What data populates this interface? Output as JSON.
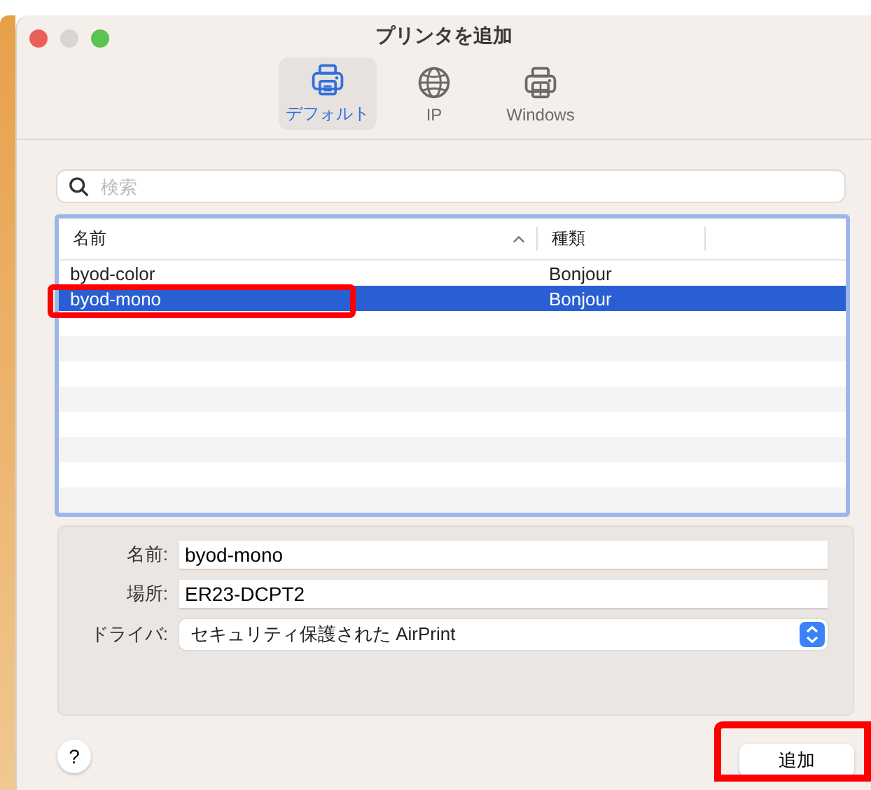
{
  "window": {
    "title": "プリンタを追加"
  },
  "tabs": [
    {
      "label": "デフォルト",
      "kind": "printer",
      "selected": true
    },
    {
      "label": "IP",
      "kind": "globe",
      "selected": false
    },
    {
      "label": "Windows",
      "kind": "windows-printer",
      "selected": false
    }
  ],
  "search": {
    "placeholder": "検索"
  },
  "table": {
    "columns": [
      {
        "label": "名前",
        "sorted": true
      },
      {
        "label": "種類",
        "sorted": false
      }
    ],
    "rows": [
      {
        "name": "byod-color",
        "type": "Bonjour",
        "selected": false,
        "highlighted": false
      },
      {
        "name": "byod-mono",
        "type": "Bonjour",
        "selected": true,
        "highlighted": true
      }
    ]
  },
  "form": {
    "name_label": "名前:",
    "name_value": "byod-mono",
    "location_label": "場所:",
    "location_value": "ER23-DCPT2",
    "driver_label": "ドライバ:",
    "driver_value": "セキュリティ保護された AirPrint"
  },
  "help": "?",
  "add_button": {
    "label": "追加",
    "highlighted": true
  }
}
